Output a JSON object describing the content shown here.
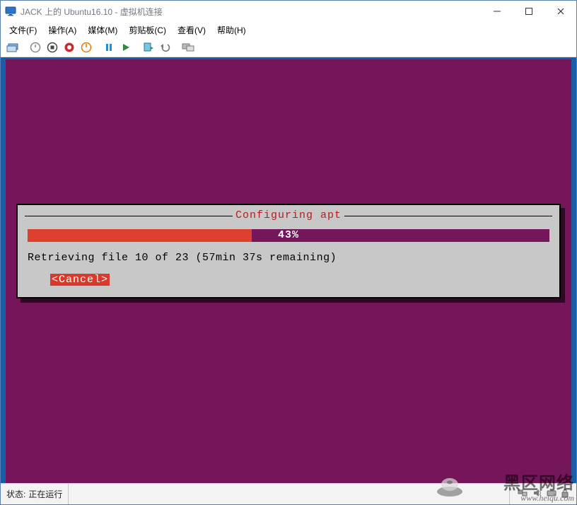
{
  "window": {
    "title": "JACK 上的 Ubuntu16.10 - 虚拟机连接"
  },
  "menus": {
    "file": "文件(F)",
    "action": "操作(A)",
    "media": "媒体(M)",
    "clip": "剪贴板(C)",
    "view": "查看(V)",
    "help": "帮助(H)"
  },
  "dialog": {
    "title": "Configuring apt",
    "progress_pct": 43,
    "progress_label": "43%",
    "status": "Retrieving file 10 of 23 (57min 37s remaining)",
    "cancel": "<Cancel>"
  },
  "statusbar": {
    "label": "状态:",
    "value": "正在运行"
  },
  "watermark": {
    "line1": "黑区网络",
    "line2": "www.heiqu.com"
  }
}
